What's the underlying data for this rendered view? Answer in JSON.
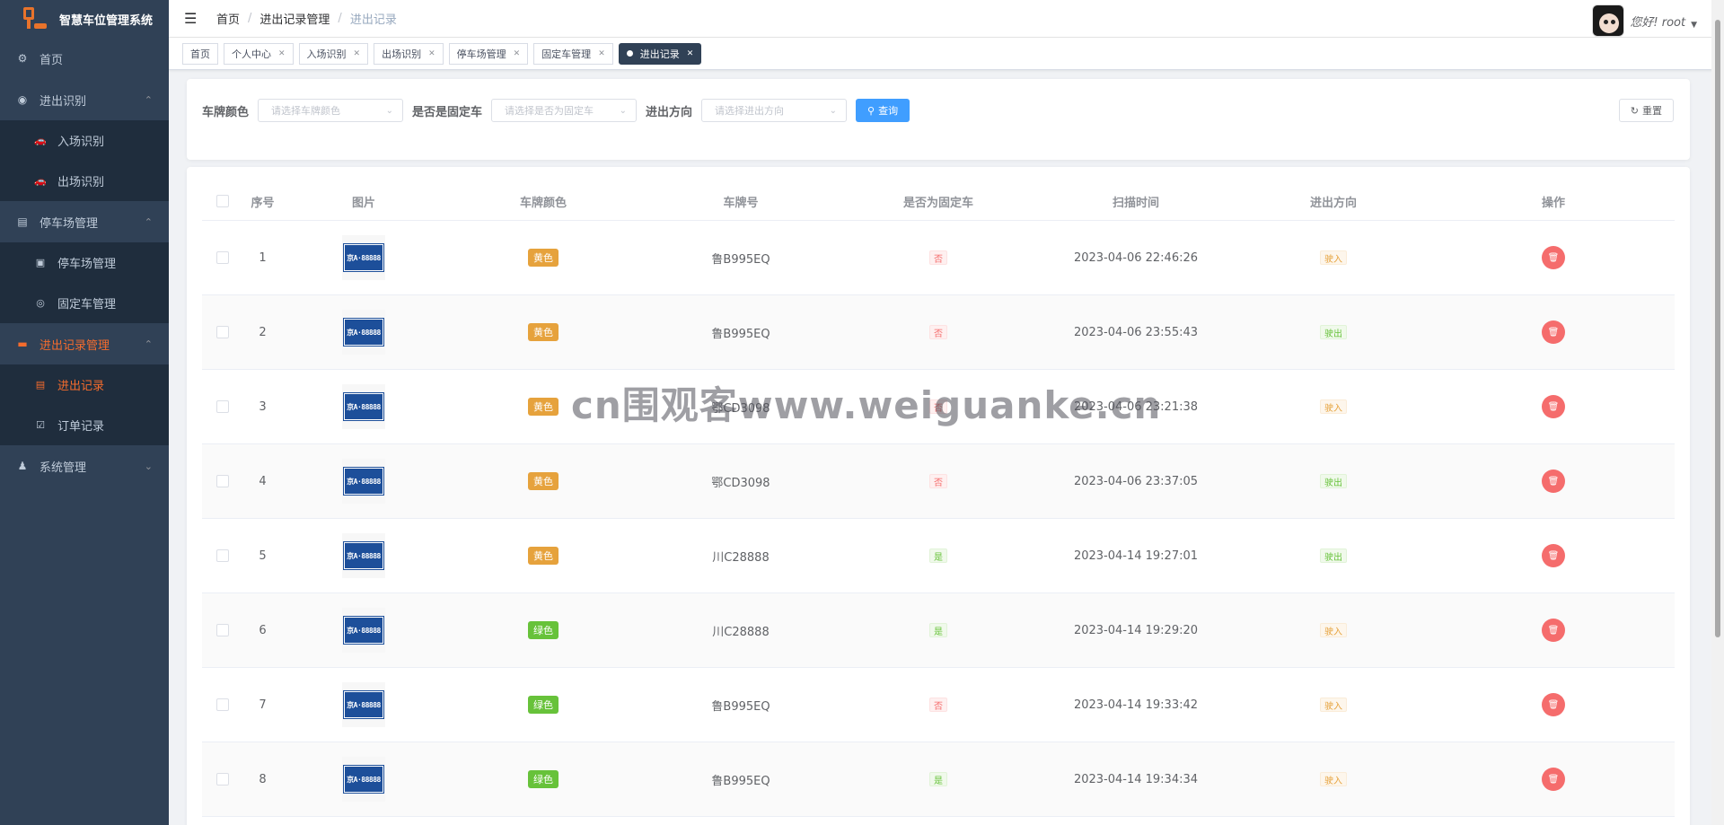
{
  "app": {
    "title": "智慧车位管理系统"
  },
  "sidebar": {
    "items": [
      {
        "label": "首页",
        "icon": "dashboard-icon"
      },
      {
        "label": "进出识别",
        "icon": "camera-icon",
        "children": [
          {
            "label": "入场识别",
            "icon": "car-icon"
          },
          {
            "label": "出场识别",
            "icon": "car-icon"
          }
        ]
      },
      {
        "label": "停车场管理",
        "icon": "document-icon",
        "children": [
          {
            "label": "停车场管理",
            "icon": "parking-icon"
          },
          {
            "label": "固定车管理",
            "icon": "target-icon"
          }
        ]
      },
      {
        "label": "进出记录管理",
        "icon": "records-icon",
        "active": true,
        "children": [
          {
            "label": "进出记录",
            "icon": "list-icon",
            "active": true
          },
          {
            "label": "订单记录",
            "icon": "order-icon"
          }
        ]
      },
      {
        "label": "系统管理",
        "icon": "user-icon"
      }
    ]
  },
  "header": {
    "breadcrumb": [
      "首页",
      "进出记录管理",
      "进出记录"
    ],
    "greeting": "您好! root"
  },
  "tags": [
    {
      "label": "首页",
      "closable": false
    },
    {
      "label": "个人中心",
      "closable": true
    },
    {
      "label": "入场识别",
      "closable": true
    },
    {
      "label": "出场识别",
      "closable": true
    },
    {
      "label": "停车场管理",
      "closable": true
    },
    {
      "label": "固定车管理",
      "closable": true
    },
    {
      "label": "进出记录",
      "closable": true,
      "active": true
    }
  ],
  "search": {
    "plate_color_label": "车牌颜色",
    "plate_color_placeholder": "请选择车牌颜色",
    "fixed_label": "是否是固定车",
    "fixed_placeholder": "请选择是否为固定车",
    "direction_label": "进出方向",
    "direction_placeholder": "请选择进出方向",
    "query_button": "查询",
    "reset_button": "重置"
  },
  "table": {
    "columns": [
      "序号",
      "图片",
      "车牌颜色",
      "车牌号",
      "是否为固定车",
      "扫描时间",
      "进出方向",
      "操作"
    ],
    "plate_image_text": "京A·88888",
    "rows": [
      {
        "index": "1",
        "color": "黄色",
        "color_type": "yellow",
        "plate": "鲁B995EQ",
        "fixed": "否",
        "time": "2023-04-06 22:46:26",
        "direction": "驶入"
      },
      {
        "index": "2",
        "color": "黄色",
        "color_type": "yellow",
        "plate": "鲁B995EQ",
        "fixed": "否",
        "time": "2023-04-06 23:55:43",
        "direction": "驶出"
      },
      {
        "index": "3",
        "color": "黄色",
        "color_type": "yellow",
        "plate": "鄂CD3098",
        "fixed": "否",
        "time": "2023-04-06 23:21:38",
        "direction": "驶入"
      },
      {
        "index": "4",
        "color": "黄色",
        "color_type": "yellow",
        "plate": "鄂CD3098",
        "fixed": "否",
        "time": "2023-04-06 23:37:05",
        "direction": "驶出"
      },
      {
        "index": "5",
        "color": "黄色",
        "color_type": "yellow",
        "plate": "川C28888",
        "fixed": "是",
        "time": "2023-04-14 19:27:01",
        "direction": "驶出"
      },
      {
        "index": "6",
        "color": "绿色",
        "color_type": "green",
        "plate": "川C28888",
        "fixed": "是",
        "time": "2023-04-14 19:29:20",
        "direction": "驶入"
      },
      {
        "index": "7",
        "color": "绿色",
        "color_type": "green",
        "plate": "鲁B995EQ",
        "fixed": "否",
        "time": "2023-04-14 19:33:42",
        "direction": "驶入"
      },
      {
        "index": "8",
        "color": "绿色",
        "color_type": "green",
        "plate": "鲁B995EQ",
        "fixed": "是",
        "time": "2023-04-14 19:34:34",
        "direction": "驶入"
      }
    ]
  },
  "watermark": "cn围观客www.weiguanke.cn",
  "colors": {
    "sidebar_bg": "#304156",
    "accent": "#f56c2d",
    "primary": "#409eff",
    "danger": "#f56c6c",
    "warning": "#e6a23c",
    "success": "#67c23a"
  }
}
